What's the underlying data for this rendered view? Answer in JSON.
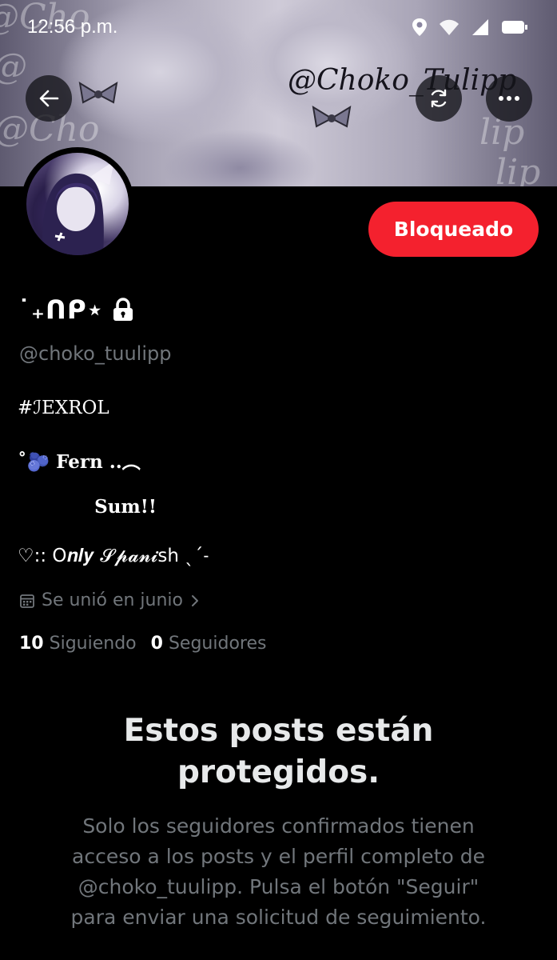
{
  "status_bar": {
    "time": "12:56 p.m."
  },
  "banner": {
    "watermark": "@Choko_Tulipp"
  },
  "header_buttons": {
    "back_icon": "arrow-left-icon",
    "refresh_icon": "refresh-icon",
    "more_icon": "more-horizontal-icon"
  },
  "profile": {
    "display_name": "˙₊ᑎᑭ⋆",
    "handle": "@choko_tuulipp",
    "bio_lines": [
      "#ℐEXROL",
      "˚🫐 Fern ..︵",
      "            Sum!!",
      "♡:: O𝒏𝒍𝒚 𝓢𝓹𝓪𝓷𝓲sh ˎˊ˗"
    ],
    "joined": "Se unió en junio",
    "following_count": "10",
    "following_label": "Siguiendo",
    "followers_count": "0",
    "followers_label": "Seguidores",
    "blocked_button": "Bloqueado"
  },
  "protected_notice": {
    "title_line1": "Estos posts están",
    "title_line2": "protegidos.",
    "description_lines": [
      "Solo los seguidores confirmados tienen",
      "acceso a los posts y el perfil completo de",
      "@choko_tuulipp. Pulsa el botón \"Seguir\"",
      "para enviar una solicitud de seguimiento."
    ]
  },
  "colors": {
    "background": "#000000",
    "blocked_red": "#f4212e",
    "secondary_text": "#71767b",
    "primary_text": "#e7e9ea"
  }
}
